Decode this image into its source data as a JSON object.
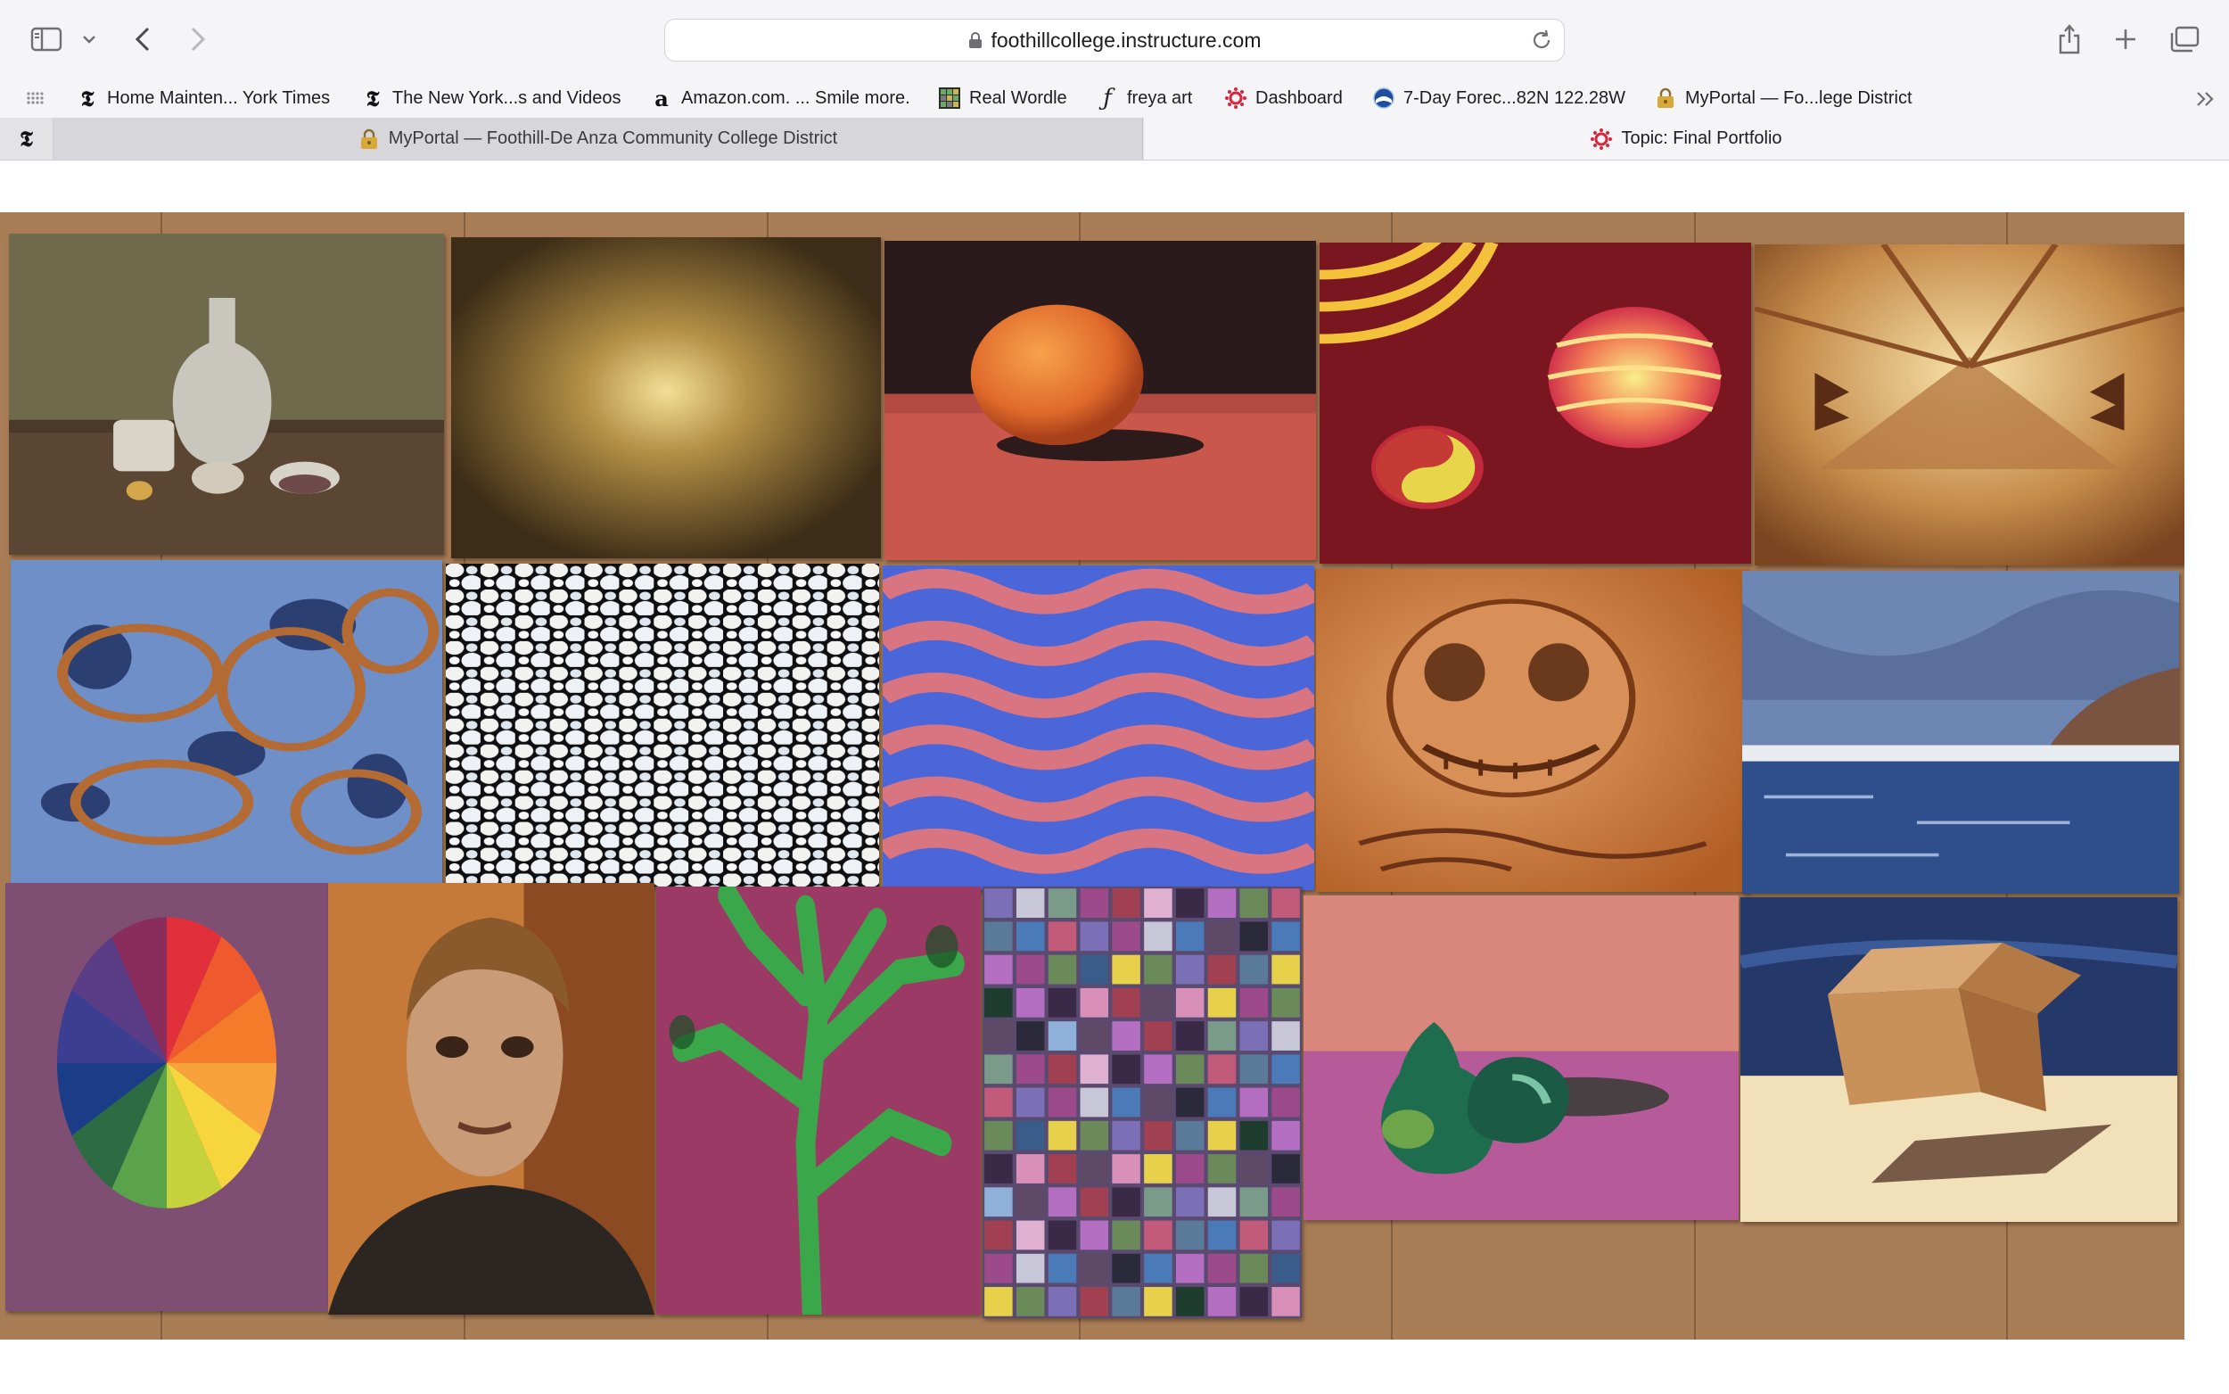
{
  "browser": {
    "address_url": "foothillcollege.instructure.com"
  },
  "bookmarks": [
    {
      "label": "Home Mainten... York Times",
      "icon": "nyt-icon"
    },
    {
      "label": "The New York...s and Videos",
      "icon": "nyt-icon"
    },
    {
      "label": "Amazon.com. ... Smile more.",
      "icon": "amazon-icon"
    },
    {
      "label": "Real Wordle",
      "icon": "wordle-grid-icon"
    },
    {
      "label": "freya art",
      "icon": "cursive-f-icon"
    },
    {
      "label": "Dashboard",
      "icon": "canvas-logo-icon"
    },
    {
      "label": "7-Day Forec...82N 122.28W",
      "icon": "noaa-icon"
    },
    {
      "label": "MyPortal — Fo...lege District",
      "icon": "lock-icon"
    }
  ],
  "tabs": [
    {
      "label": "MyPortal — Foothill-De Anza Community College District",
      "icon": "lock-icon",
      "active": false
    },
    {
      "label": "Topic: Final Portfolio",
      "icon": "canvas-logo-icon",
      "active": true
    }
  ],
  "icons": {
    "sidebar": "sidebar-icon",
    "back": "chevron-left-icon",
    "forward": "chevron-right-icon",
    "share": "share-icon",
    "new_tab": "plus-icon",
    "tab_overview": "tab-overview-icon",
    "reload": "reload-icon",
    "overflow": "double-chevron-right-icon"
  },
  "colors": {
    "toolbar_bg": "#f5f5f7",
    "tabbar_bg": "#e3e3e6",
    "canvas_red": "#d7263d"
  }
}
